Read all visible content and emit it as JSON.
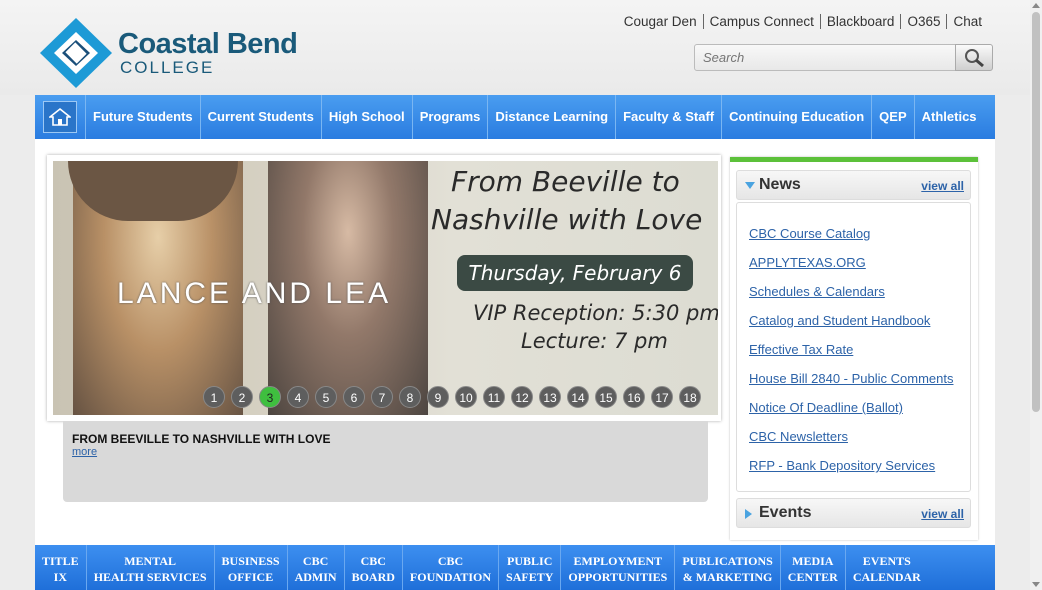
{
  "logo": {
    "line1": "Coastal Bend",
    "line2": "COLLEGE"
  },
  "utility_links": [
    "Cougar Den",
    "Campus Connect",
    "Blackboard",
    "O365",
    "Chat"
  ],
  "search": {
    "placeholder": "Search"
  },
  "nav": {
    "home_icon": "house-icon",
    "items": [
      "Future Students",
      "Current Students",
      "High School",
      "Programs",
      "Distance Learning",
      "Faculty & Staff",
      "Continuing Education",
      "QEP",
      "Athletics"
    ]
  },
  "slide": {
    "band_name": "LANCE AND LEA",
    "title_line1": "From Beeville to",
    "title_line2": "Nashville with Love",
    "date": "Thursday, February 6",
    "detail1": "VIP Reception: 5:30 pm",
    "detail2": "Lecture: 7 pm",
    "pages": [
      "1",
      "2",
      "3",
      "4",
      "5",
      "6",
      "7",
      "8",
      "9",
      "10",
      "11",
      "12",
      "13",
      "14",
      "15",
      "16",
      "17",
      "18"
    ],
    "active_page": "3"
  },
  "caption": {
    "title": "FROM BEEVILLE TO NASHVILLE WITH LOVE",
    "more": "more"
  },
  "news": {
    "title": "News",
    "view_all": "view all",
    "items": [
      "CBC Course Catalog",
      "APPLYTEXAS.ORG",
      "Schedules & Calendars",
      "Catalog and Student Handbook",
      "Effective Tax Rate",
      "House Bill 2840 - Public Comments",
      "Notice Of Deadline (Ballot)",
      "CBC Newsletters",
      "RFP - Bank Depository Services"
    ]
  },
  "events": {
    "title": "Events",
    "view_all": "view all"
  },
  "bottom_nav": [
    {
      "l1": "TITLE",
      "l2": "IX"
    },
    {
      "l1": "MENTAL",
      "l2": "HEALTH SERVICES"
    },
    {
      "l1": "BUSINESS",
      "l2": "OFFICE"
    },
    {
      "l1": "CBC",
      "l2": "ADMIN"
    },
    {
      "l1": "CBC",
      "l2": "BOARD"
    },
    {
      "l1": "CBC",
      "l2": "FOUNDATION"
    },
    {
      "l1": "PUBLIC",
      "l2": "SAFETY"
    },
    {
      "l1": "EMPLOYMENT",
      "l2": "OPPORTUNITIES"
    },
    {
      "l1": "PUBLICATIONS",
      "l2": "& MARKETING"
    },
    {
      "l1": "MEDIA",
      "l2": "CENTER"
    },
    {
      "l1": "EVENTS",
      "l2": "CALENDAR"
    }
  ],
  "colors": {
    "accent_blue": "#2a7ce0",
    "news_green": "#5cc13a",
    "link_blue": "#2d63a8",
    "logo_teal": "#1a5a7a"
  }
}
